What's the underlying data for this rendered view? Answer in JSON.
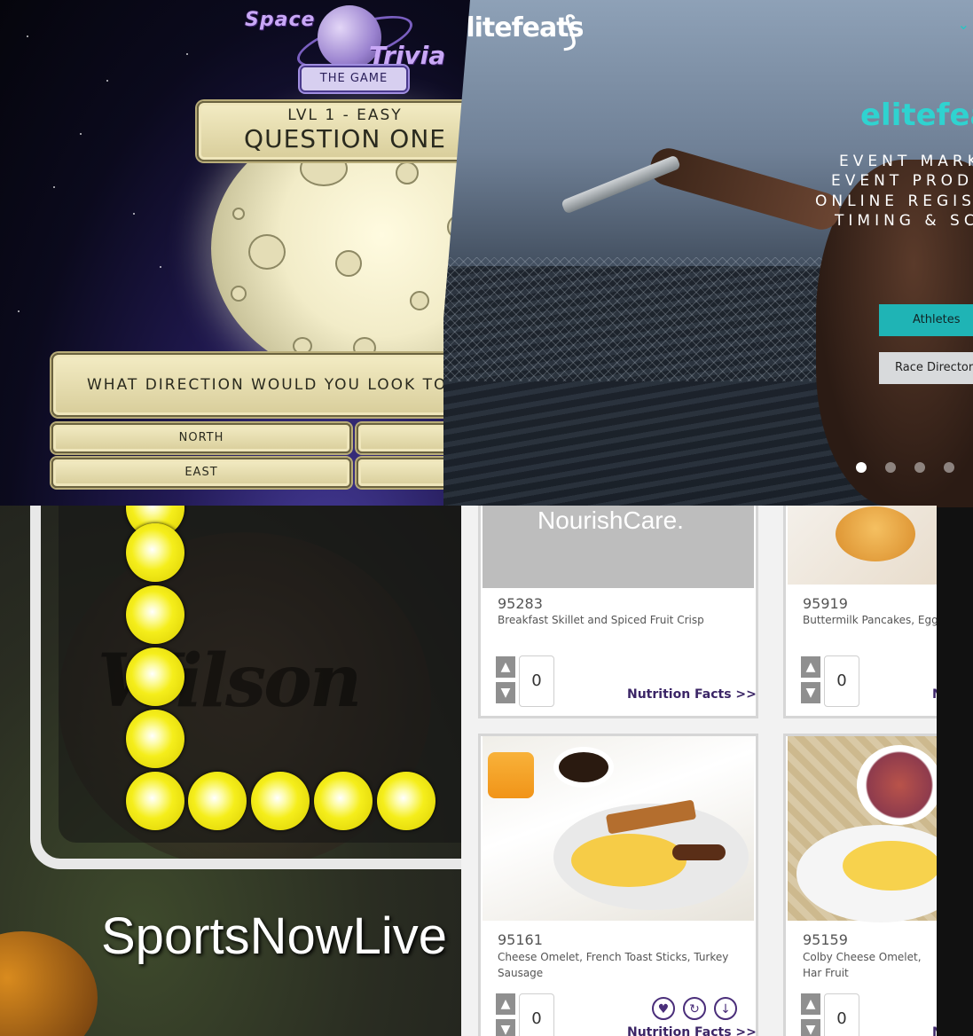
{
  "trivia": {
    "logo_word1": "Space",
    "logo_word2": "Trivia",
    "game_badge": "THE GAME",
    "level": "LVL 1 - EASY",
    "question_number": "QUESTION ONE",
    "question_text": "WHAT DIRECTION WOULD YOU LOOK TO C",
    "answers": [
      "NORTH",
      "",
      "EAST",
      ""
    ]
  },
  "elite": {
    "brand": "elitefeats",
    "hero_brand": "elitefea",
    "services": [
      "EVENT MARKE",
      "EVENT PRODU",
      "ONLINE REGIST",
      "TIMING & SCO"
    ],
    "buttons": {
      "athletes": "Athletes",
      "race_directors": "Race Directors"
    },
    "carousel_dots": 4,
    "active_dot": 0,
    "accent_color": "#23c7c4"
  },
  "sports": {
    "title": "SportsNowLive",
    "ball_brand": "Wilson"
  },
  "nourish": {
    "logo": "NourishCare.",
    "cards": [
      {
        "code": "95283",
        "name": "Breakfast Skillet and Spiced Fruit Crisp",
        "qty": "0",
        "link": "Nutrition Facts >>"
      },
      {
        "code": "95919",
        "name": "Buttermilk Pancakes, Egg F",
        "qty": "0",
        "link": "N"
      },
      {
        "code": "95161",
        "name": "Cheese Omelet, French Toast Sticks, Turkey Sausage",
        "qty": "0",
        "link": "Nutrition Facts >>"
      },
      {
        "code": "95159",
        "name": "Colby Cheese Omelet, Har Fruit",
        "qty": "0",
        "link": "N"
      }
    ],
    "brand_color": "#3b2566"
  }
}
